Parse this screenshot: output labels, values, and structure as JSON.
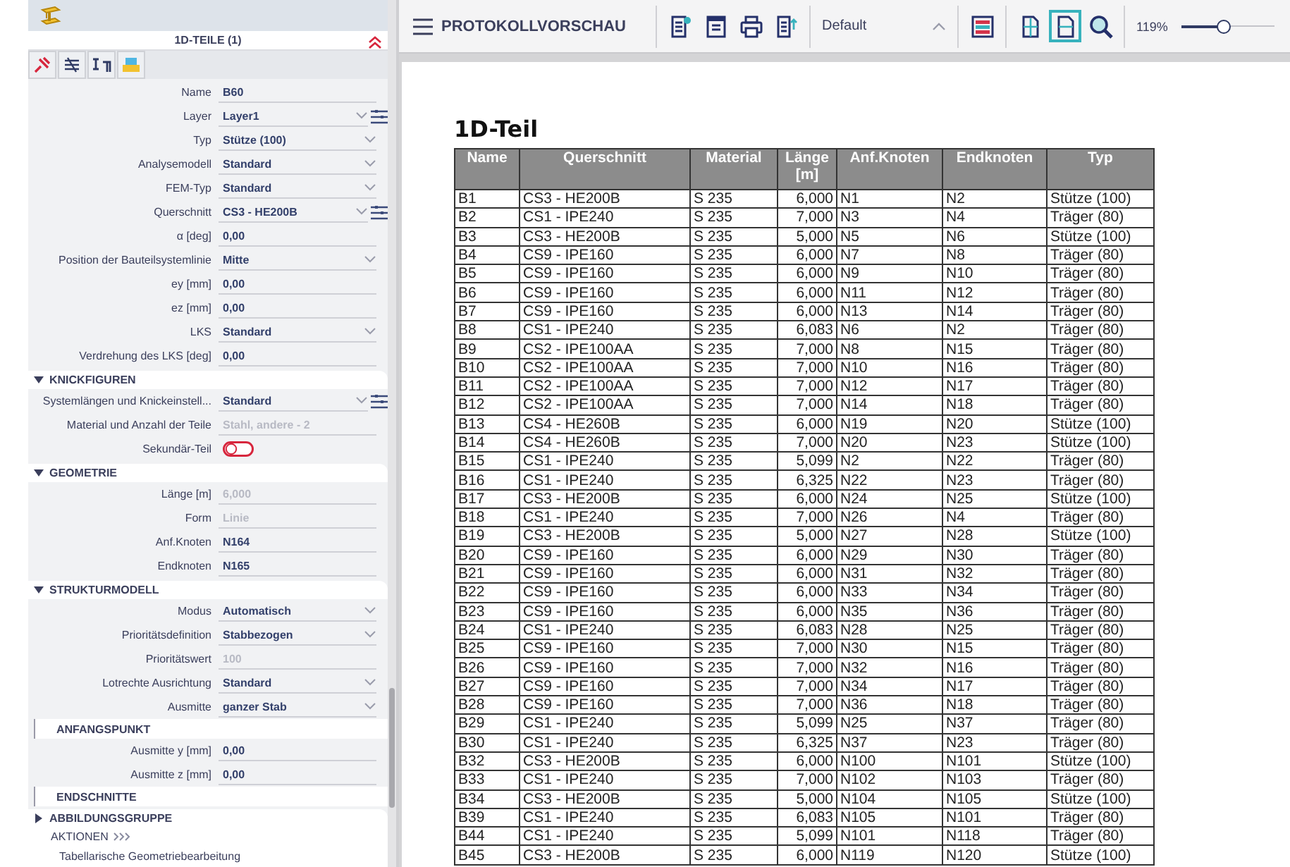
{
  "panel": {
    "title": "1D-TEILE (1)",
    "rows": [
      {
        "kind": "text",
        "label": "Name",
        "value": "B60",
        "disabled": false
      },
      {
        "kind": "select",
        "label": "Layer",
        "value": "Layer1",
        "menu": true,
        "disabled": false
      },
      {
        "kind": "select",
        "label": "Typ",
        "value": "Stütze (100)",
        "menu": false,
        "disabled": false
      },
      {
        "kind": "select",
        "label": "Analysemodell",
        "value": "Standard",
        "menu": false,
        "disabled": false
      },
      {
        "kind": "select",
        "label": "FEM-Typ",
        "value": "Standard",
        "menu": false,
        "disabled": false
      },
      {
        "kind": "select",
        "label": "Querschnitt",
        "value": "CS3 - HE200B",
        "menu": true,
        "disabled": false
      },
      {
        "kind": "text",
        "label": "α [deg]",
        "value": "0,00",
        "disabled": false
      },
      {
        "kind": "select",
        "label": "Position der Bauteilsystemlinie",
        "value": "Mitte",
        "menu": false,
        "disabled": false
      },
      {
        "kind": "text",
        "label": "ey [mm]",
        "value": "0,00",
        "disabled": false
      },
      {
        "kind": "text",
        "label": "ez [mm]",
        "value": "0,00",
        "disabled": false
      },
      {
        "kind": "select",
        "label": "LKS",
        "value": "Standard",
        "menu": false,
        "disabled": false
      },
      {
        "kind": "text",
        "label": "Verdrehung des LKS [deg]",
        "value": "0,00",
        "disabled": false
      },
      {
        "kind": "section",
        "label": "KNICKFIGUREN",
        "expanded": true
      },
      {
        "kind": "select",
        "label": "Systemlängen und Knickeinstell...",
        "value": "Standard",
        "menu": true,
        "disabled": false
      },
      {
        "kind": "text",
        "label": "Material und Anzahl der Teile",
        "value": "Stahl, andere - 2",
        "disabled": true
      },
      {
        "kind": "toggle",
        "label": "Sekundär-Teil",
        "on": false
      },
      {
        "kind": "section",
        "label": "GEOMETRIE",
        "expanded": true
      },
      {
        "kind": "text",
        "label": "Länge [m]",
        "value": "6,000",
        "disabled": true
      },
      {
        "kind": "text",
        "label": "Form",
        "value": "Linie",
        "disabled": true
      },
      {
        "kind": "text",
        "label": "Anf.Knoten",
        "value": "N164",
        "disabled": false
      },
      {
        "kind": "text",
        "label": "Endknoten",
        "value": "N165",
        "disabled": false
      },
      {
        "kind": "section",
        "label": "STRUKTURMODELL",
        "expanded": true
      },
      {
        "kind": "select",
        "label": "Modus",
        "value": "Automatisch",
        "menu": false,
        "disabled": false
      },
      {
        "kind": "select",
        "label": "Prioritätsdefinition",
        "value": "Stabbezogen",
        "menu": false,
        "disabled": false
      },
      {
        "kind": "text",
        "label": "Prioritätswert",
        "value": "100",
        "disabled": true
      },
      {
        "kind": "select",
        "label": "Lotrechte Ausrichtung",
        "value": "Standard",
        "menu": false,
        "disabled": false
      },
      {
        "kind": "select",
        "label": "Ausmitte",
        "value": "ganzer Stab",
        "menu": false,
        "disabled": false
      },
      {
        "kind": "subheader",
        "label": "ANFANGSPUNKT"
      },
      {
        "kind": "text",
        "label": "Ausmitte y [mm]",
        "value": "0,00",
        "disabled": false
      },
      {
        "kind": "text",
        "label": "Ausmitte z [mm]",
        "value": "0,00",
        "disabled": false
      },
      {
        "kind": "subheader",
        "label": "ENDSCHNITTE"
      },
      {
        "kind": "section",
        "label": "ABBILDUNGSGRUPPE",
        "expanded": false
      },
      {
        "kind": "actions",
        "label": "AKTIONEN"
      },
      {
        "kind": "action",
        "label": "Tabellarische Geometriebearbeitung"
      }
    ]
  },
  "toolbar": {
    "title": "PROTOKOLLVORSCHAU",
    "template": "Default",
    "zoom": "119%",
    "zoom_slider": {
      "level": 0.45
    },
    "view_buttons": [
      {
        "kind": "layout",
        "selected": false
      },
      {
        "kind": "split",
        "selected": false
      },
      {
        "kind": "page",
        "selected": true
      },
      {
        "kind": "zoom",
        "selected": false
      }
    ]
  },
  "report": {
    "title": "1D-Teil",
    "columns": [
      "Name",
      "Querschnitt",
      "Material",
      "Länge [m]",
      "Anf.Knoten",
      "Endknoten",
      "Typ"
    ],
    "rows": [
      [
        "B1",
        "CS3 - HE200B",
        "S 235",
        "6,000",
        "N1",
        "N2",
        "Stütze (100)"
      ],
      [
        "B2",
        "CS1 - IPE240",
        "S 235",
        "7,000",
        "N3",
        "N4",
        "Träger (80)"
      ],
      [
        "B3",
        "CS3 - HE200B",
        "S 235",
        "5,000",
        "N5",
        "N6",
        "Stütze (100)"
      ],
      [
        "B4",
        "CS9 - IPE160",
        "S 235",
        "6,000",
        "N7",
        "N8",
        "Träger (80)"
      ],
      [
        "B5",
        "CS9 - IPE160",
        "S 235",
        "6,000",
        "N9",
        "N10",
        "Träger (80)"
      ],
      [
        "B6",
        "CS9 - IPE160",
        "S 235",
        "6,000",
        "N11",
        "N12",
        "Träger (80)"
      ],
      [
        "B7",
        "CS9 - IPE160",
        "S 235",
        "6,000",
        "N13",
        "N14",
        "Träger (80)"
      ],
      [
        "B8",
        "CS1 - IPE240",
        "S 235",
        "6,083",
        "N6",
        "N2",
        "Träger (80)"
      ],
      [
        "B9",
        "CS2 - IPE100AA",
        "S 235",
        "7,000",
        "N8",
        "N15",
        "Träger (80)"
      ],
      [
        "B10",
        "CS2 - IPE100AA",
        "S 235",
        "7,000",
        "N10",
        "N16",
        "Träger (80)"
      ],
      [
        "B11",
        "CS2 - IPE100AA",
        "S 235",
        "7,000",
        "N12",
        "N17",
        "Träger (80)"
      ],
      [
        "B12",
        "CS2 - IPE100AA",
        "S 235",
        "7,000",
        "N14",
        "N18",
        "Träger (80)"
      ],
      [
        "B13",
        "CS4 - HE260B",
        "S 235",
        "6,000",
        "N19",
        "N20",
        "Stütze (100)"
      ],
      [
        "B14",
        "CS4 - HE260B",
        "S 235",
        "7,000",
        "N20",
        "N23",
        "Stütze (100)"
      ],
      [
        "B15",
        "CS1 - IPE240",
        "S 235",
        "5,099",
        "N2",
        "N22",
        "Träger (80)"
      ],
      [
        "B16",
        "CS1 - IPE240",
        "S 235",
        "6,325",
        "N22",
        "N23",
        "Träger (80)"
      ],
      [
        "B17",
        "CS3 - HE200B",
        "S 235",
        "6,000",
        "N24",
        "N25",
        "Stütze (100)"
      ],
      [
        "B18",
        "CS1 - IPE240",
        "S 235",
        "7,000",
        "N26",
        "N4",
        "Träger (80)"
      ],
      [
        "B19",
        "CS3 - HE200B",
        "S 235",
        "5,000",
        "N27",
        "N28",
        "Stütze (100)"
      ],
      [
        "B20",
        "CS9 - IPE160",
        "S 235",
        "6,000",
        "N29",
        "N30",
        "Träger (80)"
      ],
      [
        "B21",
        "CS9 - IPE160",
        "S 235",
        "6,000",
        "N31",
        "N32",
        "Träger (80)"
      ],
      [
        "B22",
        "CS9 - IPE160",
        "S 235",
        "6,000",
        "N33",
        "N34",
        "Träger (80)"
      ],
      [
        "B23",
        "CS9 - IPE160",
        "S 235",
        "6,000",
        "N35",
        "N36",
        "Träger (80)"
      ],
      [
        "B24",
        "CS1 - IPE240",
        "S 235",
        "6,083",
        "N28",
        "N25",
        "Träger (80)"
      ],
      [
        "B25",
        "CS9 - IPE160",
        "S 235",
        "7,000",
        "N30",
        "N15",
        "Träger (80)"
      ],
      [
        "B26",
        "CS9 - IPE160",
        "S 235",
        "7,000",
        "N32",
        "N16",
        "Träger (80)"
      ],
      [
        "B27",
        "CS9 - IPE160",
        "S 235",
        "7,000",
        "N34",
        "N17",
        "Träger (80)"
      ],
      [
        "B28",
        "CS9 - IPE160",
        "S 235",
        "7,000",
        "N36",
        "N18",
        "Träger (80)"
      ],
      [
        "B29",
        "CS1 - IPE240",
        "S 235",
        "5,099",
        "N25",
        "N37",
        "Träger (80)"
      ],
      [
        "B30",
        "CS1 - IPE240",
        "S 235",
        "6,325",
        "N37",
        "N23",
        "Träger (80)"
      ],
      [
        "B32",
        "CS3 - HE200B",
        "S 235",
        "6,000",
        "N100",
        "N101",
        "Stütze (100)"
      ],
      [
        "B33",
        "CS1 - IPE240",
        "S 235",
        "7,000",
        "N102",
        "N103",
        "Träger (80)"
      ],
      [
        "B34",
        "CS3 - HE200B",
        "S 235",
        "5,000",
        "N104",
        "N105",
        "Stütze (100)"
      ],
      [
        "B39",
        "CS1 - IPE240",
        "S 235",
        "6,083",
        "N105",
        "N101",
        "Träger (80)"
      ],
      [
        "B44",
        "CS1 - IPE240",
        "S 235",
        "5,099",
        "N101",
        "N118",
        "Träger (80)"
      ],
      [
        "B45",
        "CS3 - HE200B",
        "S 235",
        "6,000",
        "N119",
        "N120",
        "Stütze (100)"
      ]
    ]
  }
}
